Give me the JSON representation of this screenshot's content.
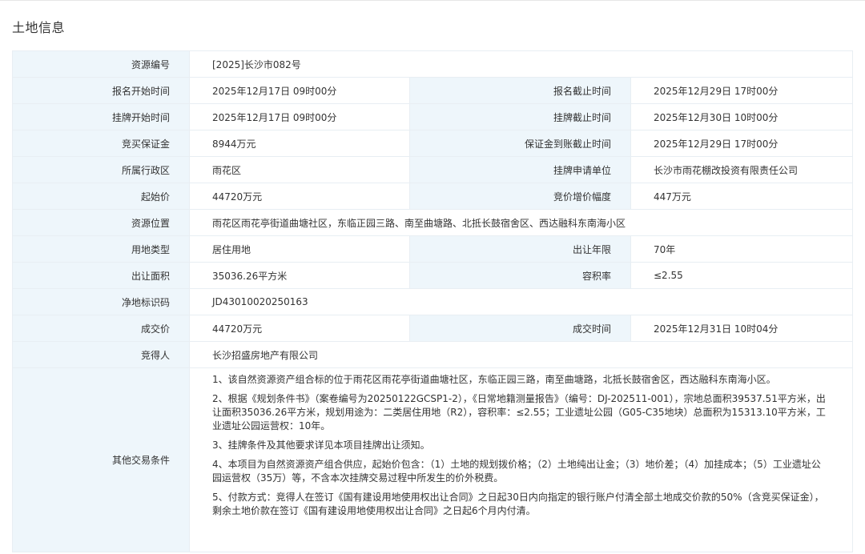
{
  "page": {
    "title": "土地信息"
  },
  "rows": {
    "resource_no": {
      "label": "资源编号",
      "value": "[2025]长沙市082号"
    },
    "reg_start": {
      "label": "报名开始时间",
      "value": "2025年12月17日 09时00分"
    },
    "reg_end": {
      "label": "报名截止时间",
      "value": "2025年12月29日 17时00分"
    },
    "list_start": {
      "label": "挂牌开始时间",
      "value": "2025年12月17日 09时00分"
    },
    "list_end": {
      "label": "挂牌截止时间",
      "value": "2025年12月30日 10时00分"
    },
    "deposit": {
      "label": "竞买保证金",
      "value": "8944万元"
    },
    "deposit_deadline": {
      "label": "保证金到账截止时间",
      "value": "2025年12月29日 17时00分"
    },
    "district": {
      "label": "所属行政区",
      "value": "雨花区"
    },
    "applicant": {
      "label": "挂牌申请单位",
      "value": "长沙市雨花棚改投资有限责任公司"
    },
    "start_price": {
      "label": "起始价",
      "value": "44720万元"
    },
    "increment": {
      "label": "竞价增价幅度",
      "value": "447万元"
    },
    "location": {
      "label": "资源位置",
      "value": "雨花区雨花亭街道曲塘社区，东临正园三路、南至曲塘路、北抵长鼓宿舍区、西达融科东南海小区"
    },
    "land_use": {
      "label": "用地类型",
      "value": "居住用地"
    },
    "term": {
      "label": "出让年限",
      "value": "70年"
    },
    "area": {
      "label": "出让面积",
      "value": "35036.26平方米"
    },
    "far": {
      "label": "容积率",
      "value": "≤2.55"
    },
    "net_code": {
      "label": "净地标识码",
      "value": "JD43010020250163"
    },
    "deal_price": {
      "label": "成交价",
      "value": "44720万元"
    },
    "deal_time": {
      "label": "成交时间",
      "value": "2025年12月31日 10时04分"
    },
    "winner": {
      "label": "竞得人",
      "value": "长沙招盛房地产有限公司"
    },
    "other_conditions": {
      "label": "其他交易条件",
      "items": [
        "1、该自然资源资产组合标的位于雨花区雨花亭街道曲塘社区，东临正园三路，南至曲塘路，北抵长鼓宿舍区，西达融科东南海小区。",
        "2、根据《规划条件书》（案卷编号为20250122GCSP1-2），《日常地籍测量报告》（编号：DJ-202511-001），宗地总面积39537.51平方米，出让面积35036.26平方米，规划用途为：二类居住用地（R2），容积率：≤2.55；工业遗址公园（G05-C35地块）总面积为15313.10平方米，工业遗址公园运营权：10年。",
        "3、挂牌条件及其他要求详见本项目挂牌出让须知。",
        "4、本项目为自然资源资产组合供应，起始价包含：（1）土地的规划拨价格；（2）土地纯出让金；（3）地价差；（4）加挂成本；（5）工业遗址公园运营权（35万）等，不含本次挂牌交易过程中所发生的价外税费。",
        "5、付款方式：竞得人在签订《国有建设用地使用权出让合同》之日起30日内向指定的银行账户付清全部土地成交价款的50%（含竞买保证金），剩余土地价款在签订《国有建设用地使用权出让合同》之日起6个月内付清。"
      ]
    }
  }
}
